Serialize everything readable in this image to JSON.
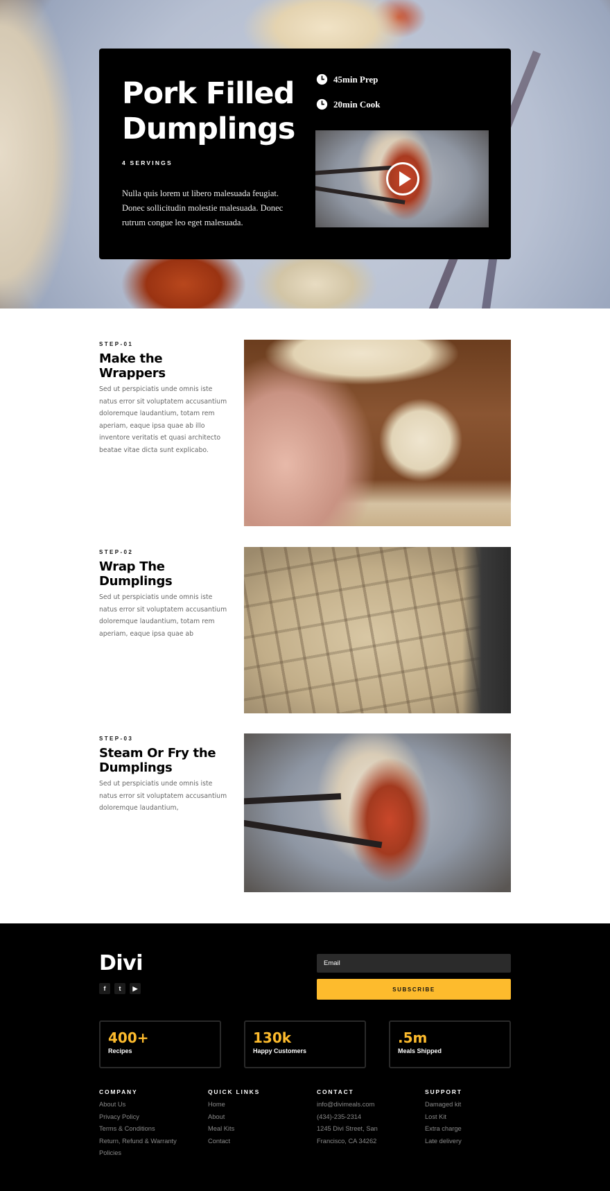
{
  "hero": {
    "title": "Pork Filled Dumplings",
    "servings": "4 SERVINGS",
    "description": "Nulla quis lorem ut libero malesuada feugiat. Donec sollicitudin molestie malesuada. Donec rutrum congue leo eget malesuada.",
    "prep": "45min Prep",
    "cook": "20min Cook",
    "icons": {
      "prep": "clock-icon",
      "cook": "clock-icon",
      "video": "play-icon"
    }
  },
  "steps": [
    {
      "label": "STEP-01",
      "title": "Make the Wrappers",
      "text": "Sed ut perspiciatis unde omnis iste natus error sit voluptatem accusantium doloremque laudantium, totam rem aperiam, eaque ipsa quae ab illo inventore veritatis et quasi architecto beatae vitae dicta sunt explicabo."
    },
    {
      "label": "STEP-02",
      "title": "Wrap The Dumplings",
      "text": "Sed ut perspiciatis unde omnis iste natus error sit voluptatem accusantium doloremque laudantium, totam rem aperiam, eaque ipsa quae ab"
    },
    {
      "label": "STEP-03",
      "title": "Steam Or Fry the Dumplings",
      "text": "Sed ut perspiciatis unde omnis iste natus error sit voluptatem accusantium doloremque laudantium,"
    }
  ],
  "footer": {
    "logo": "Divi",
    "social": [
      {
        "name": "facebook-icon",
        "glyph": "f"
      },
      {
        "name": "twitter-icon",
        "glyph": "t"
      },
      {
        "name": "youtube-icon",
        "glyph": "▶"
      }
    ],
    "email_placeholder": "Email",
    "subscribe_label": "SUBSCRIBE",
    "stats": [
      {
        "number": "400+",
        "label": "Recipes"
      },
      {
        "number": "130k",
        "label": "Happy Customers"
      },
      {
        "number": ".5m",
        "label": "Meals Shipped"
      }
    ],
    "columns": [
      {
        "heading": "COMPANY",
        "links": [
          "About Us",
          "Privacy Policy",
          "Terms & Conditions",
          "Return, Refund & Warranty Policies"
        ]
      },
      {
        "heading": "QUICK LINKS",
        "links": [
          "Home",
          "About",
          "Meal Kits",
          "Contact"
        ]
      },
      {
        "heading": "CONTACT",
        "links": [
          "info@divimeals.com",
          "(434)-235-2314",
          "1245 Divi Street, San Francisco, CA 34262"
        ]
      },
      {
        "heading": "SUPPORT",
        "links": [
          "Damaged kit",
          "Lost Kit",
          "Extra charge",
          "Late delivery"
        ]
      }
    ]
  },
  "colors": {
    "accent": "#fdbb2d",
    "card": "#000000",
    "footer": "#000000"
  }
}
